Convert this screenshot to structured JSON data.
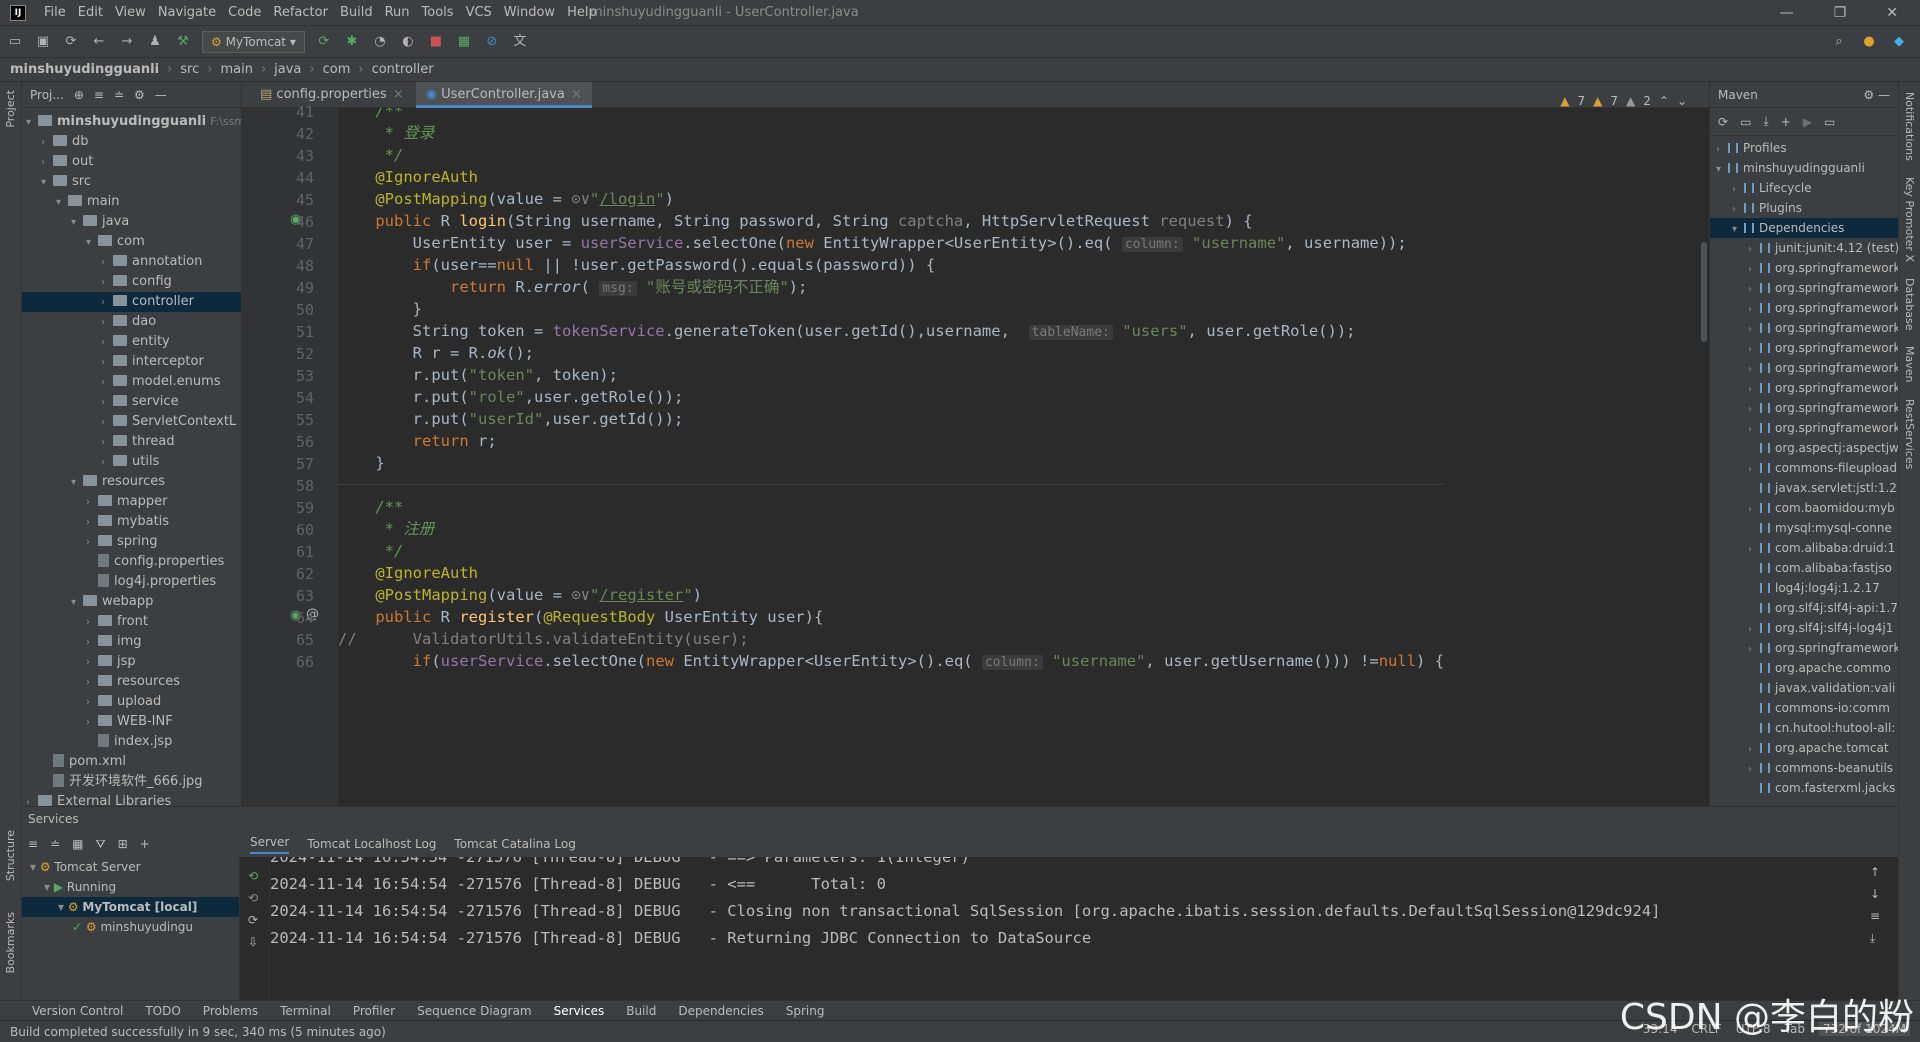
{
  "app": {
    "title": "minshuyudingguanli - UserController.java",
    "logo": "IJ"
  },
  "menu": [
    "File",
    "Edit",
    "View",
    "Navigate",
    "Code",
    "Refactor",
    "Build",
    "Run",
    "Tools",
    "VCS",
    "Window",
    "Help"
  ],
  "toolbar": {
    "run_config": "MyTomcat"
  },
  "breadcrumbs": [
    "minshuyudingguanli",
    "src",
    "main",
    "java",
    "com",
    "controller"
  ],
  "left_strip": {
    "project": "Project",
    "structure": "Structure",
    "bookmarks": "Bookmarks"
  },
  "right_strip": [
    "Notifications",
    "Key Promoter X",
    "Database",
    "Maven",
    "RestServices"
  ],
  "project_panel": {
    "header": "Proj...",
    "tree": [
      {
        "label": "minshuyudingguanli",
        "extra": "F:\\ssm",
        "indent": 0,
        "type": "folder",
        "open": true
      },
      {
        "label": "db",
        "indent": 1,
        "type": "folder"
      },
      {
        "label": "out",
        "indent": 1,
        "type": "folder"
      },
      {
        "label": "src",
        "indent": 1,
        "type": "folder",
        "open": true
      },
      {
        "label": "main",
        "indent": 2,
        "type": "folder",
        "open": true
      },
      {
        "label": "java",
        "indent": 3,
        "type": "folder",
        "open": true
      },
      {
        "label": "com",
        "indent": 4,
        "type": "folder",
        "open": true
      },
      {
        "label": "annotation",
        "indent": 5,
        "type": "folder"
      },
      {
        "label": "config",
        "indent": 5,
        "type": "folder"
      },
      {
        "label": "controller",
        "indent": 5,
        "type": "folder",
        "selected": true
      },
      {
        "label": "dao",
        "indent": 5,
        "type": "folder"
      },
      {
        "label": "entity",
        "indent": 5,
        "type": "folder"
      },
      {
        "label": "interceptor",
        "indent": 5,
        "type": "folder"
      },
      {
        "label": "model.enums",
        "indent": 5,
        "type": "folder"
      },
      {
        "label": "service",
        "indent": 5,
        "type": "folder"
      },
      {
        "label": "ServletContextL",
        "indent": 5,
        "type": "folder"
      },
      {
        "label": "thread",
        "indent": 5,
        "type": "folder"
      },
      {
        "label": "utils",
        "indent": 5,
        "type": "folder"
      },
      {
        "label": "resources",
        "indent": 3,
        "type": "folder",
        "open": true
      },
      {
        "label": "mapper",
        "indent": 4,
        "type": "folder"
      },
      {
        "label": "mybatis",
        "indent": 4,
        "type": "folder"
      },
      {
        "label": "spring",
        "indent": 4,
        "type": "folder"
      },
      {
        "label": "config.properties",
        "indent": 4,
        "type": "file"
      },
      {
        "label": "log4j.properties",
        "indent": 4,
        "type": "file"
      },
      {
        "label": "webapp",
        "indent": 3,
        "type": "folder",
        "open": true
      },
      {
        "label": "front",
        "indent": 4,
        "type": "folder"
      },
      {
        "label": "img",
        "indent": 4,
        "type": "folder"
      },
      {
        "label": "jsp",
        "indent": 4,
        "type": "folder"
      },
      {
        "label": "resources",
        "indent": 4,
        "type": "folder"
      },
      {
        "label": "upload",
        "indent": 4,
        "type": "folder"
      },
      {
        "label": "WEB-INF",
        "indent": 4,
        "type": "folder"
      },
      {
        "label": "index.jsp",
        "indent": 4,
        "type": "file"
      },
      {
        "label": "pom.xml",
        "indent": 1,
        "type": "file"
      },
      {
        "label": "开发环境软件_666.jpg",
        "indent": 1,
        "type": "file"
      },
      {
        "label": "External Libraries",
        "indent": 0,
        "type": "folder"
      }
    ]
  },
  "editor": {
    "tabs": [
      {
        "label": "config.properties",
        "active": false
      },
      {
        "label": "UserController.java",
        "active": true
      }
    ],
    "warnings": [
      "7",
      "7",
      "2"
    ],
    "line_numbers": [
      "41",
      "42",
      "43",
      "44",
      "45",
      "46",
      "47",
      "48",
      "49",
      "50",
      "51",
      "52",
      "53",
      "54",
      "55",
      "56",
      "57",
      "58",
      "59",
      "60",
      "61",
      "62",
      "63",
      "64",
      "65",
      "66"
    ]
  },
  "maven": {
    "title": "Maven",
    "tree": [
      {
        "label": "Profiles",
        "indent": 0,
        "arrow": ">"
      },
      {
        "label": "minshuyudingguanli",
        "indent": 0,
        "arrow": "v"
      },
      {
        "label": "Lifecycle",
        "indent": 1,
        "arrow": ">"
      },
      {
        "label": "Plugins",
        "indent": 1,
        "arrow": ">"
      },
      {
        "label": "Dependencies",
        "indent": 1,
        "arrow": "v",
        "selected": true
      },
      {
        "label": "junit:junit:4.12 (test)",
        "indent": 2,
        "arrow": ">"
      },
      {
        "label": "org.springframework",
        "indent": 2,
        "arrow": ">"
      },
      {
        "label": "org.springframework",
        "indent": 2,
        "arrow": ">"
      },
      {
        "label": "org.springframework",
        "indent": 2,
        "arrow": ">"
      },
      {
        "label": "org.springframework",
        "indent": 2,
        "arrow": ">"
      },
      {
        "label": "org.springframework",
        "indent": 2,
        "arrow": ">"
      },
      {
        "label": "org.springframework",
        "indent": 2,
        "arrow": ">"
      },
      {
        "label": "org.springframework",
        "indent": 2,
        "arrow": ">"
      },
      {
        "label": "org.springframework",
        "indent": 2,
        "arrow": ">"
      },
      {
        "label": "org.springframework",
        "indent": 2,
        "arrow": ">"
      },
      {
        "label": "org.aspectj:aspectjw",
        "indent": 2,
        "arrow": ""
      },
      {
        "label": "commons-fileupload",
        "indent": 2,
        "arrow": ">"
      },
      {
        "label": "javax.servlet:jstl:1.2",
        "indent": 2,
        "arrow": ""
      },
      {
        "label": "com.baomidou:myb",
        "indent": 2,
        "arrow": ">"
      },
      {
        "label": "mysql:mysql-conne",
        "indent": 2,
        "arrow": ""
      },
      {
        "label": "com.alibaba:druid:1",
        "indent": 2,
        "arrow": ">"
      },
      {
        "label": "com.alibaba:fastjso",
        "indent": 2,
        "arrow": ""
      },
      {
        "label": "log4j:log4j:1.2.17",
        "indent": 2,
        "arrow": ""
      },
      {
        "label": "org.slf4j:slf4j-api:1.7",
        "indent": 2,
        "arrow": ""
      },
      {
        "label": "org.slf4j:slf4j-log4j1",
        "indent": 2,
        "arrow": ">"
      },
      {
        "label": "org.springframework",
        "indent": 2,
        "arrow": ">"
      },
      {
        "label": "org.apache.commo",
        "indent": 2,
        "arrow": ""
      },
      {
        "label": "javax.validation:vali",
        "indent": 2,
        "arrow": ""
      },
      {
        "label": "commons-io:comm",
        "indent": 2,
        "arrow": ""
      },
      {
        "label": "cn.hutool:hutool-all:",
        "indent": 2,
        "arrow": ""
      },
      {
        "label": "org.apache.tomcat",
        "indent": 2,
        "arrow": ">"
      },
      {
        "label": "commons-beanutils",
        "indent": 2,
        "arrow": ">"
      },
      {
        "label": "com.fasterxml.jacks",
        "indent": 2,
        "arrow": ""
      }
    ]
  },
  "services": {
    "title": "Services",
    "tree": [
      {
        "label": "Tomcat Server",
        "indent": 0
      },
      {
        "label": "Running",
        "indent": 1
      },
      {
        "label": "MyTomcat [local]",
        "indent": 2,
        "selected": true
      },
      {
        "label": "minshuyudingu",
        "indent": 3
      }
    ],
    "tabs": [
      "Server",
      "Tomcat Localhost Log",
      "Tomcat Catalina Log"
    ],
    "console": [
      "2024-11-14 16:54:54 -271576 [Thread-8] DEBUG   - ==> Parameters: 1(Integer)",
      "2024-11-14 16:54:54 -271576 [Thread-8] DEBUG   - <==      Total: 0",
      "2024-11-14 16:54:54 -271576 [Thread-8] DEBUG   - Closing non transactional SqlSession [org.apache.ibatis.session.defaults.DefaultSqlSession@129dc924]",
      "2024-11-14 16:54:54 -271576 [Thread-8] DEBUG   - Returning JDBC Connection to DataSource"
    ]
  },
  "bottom_tools": [
    "Version Control",
    "TODO",
    "Problems",
    "Terminal",
    "Profiler",
    "Sequence Diagram",
    "Services",
    "Build",
    "Dependencies",
    "Spring"
  ],
  "bottom_active": "Services",
  "status": {
    "message": "Build completed successfully in 9 sec, 340 ms (5 minutes ago)",
    "position": "33:14",
    "line_sep": "CRLF",
    "encoding": "UTF-8",
    "indent": "Tab",
    "memory": "732 of 1024M"
  },
  "watermark": "CSDN @李白的粉"
}
